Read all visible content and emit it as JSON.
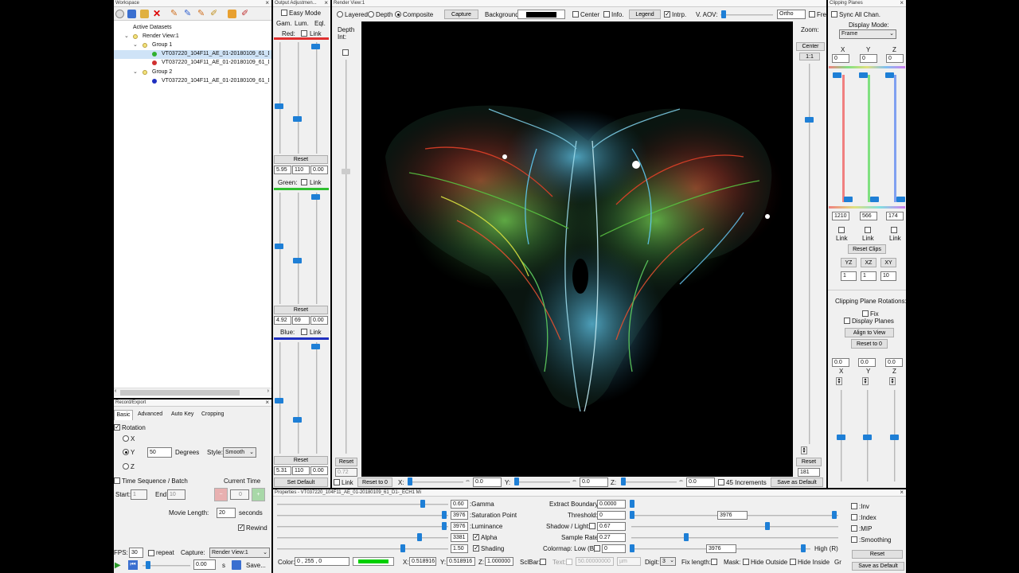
{
  "workspace": {
    "title": "Workspace",
    "tree": {
      "root": "Active Datasets",
      "view": "Render View:1",
      "group1": "Group 1",
      "g1_item1": "VT037220_104F11_AE_01-20180109_61_D1",
      "g1_item2": "VT037220_104F11_AE_01-20180109_61_D1",
      "group2": "Group 2",
      "g2_item1": "VT037220_104F11_AE_01-20180109_61_D1"
    }
  },
  "record": {
    "title": "Record/Export",
    "tabs": [
      "Basic",
      "Advanced",
      "Auto Key",
      "Cropping"
    ],
    "rotation_label": "Rotation",
    "x_label": "X",
    "y_label": "Y",
    "z_label": "Z",
    "degrees_value": "50",
    "degrees_label": "Degrees",
    "style_label": "Style:",
    "style_value": "Smooth",
    "time_seq_label": "Time Sequence / Batch",
    "current_time_label": "Current Time",
    "current_time_value": "0",
    "start_label": "Start:",
    "start_value": "1",
    "end_label": "End:",
    "end_value": "10",
    "movie_length_label": "Movie Length:",
    "movie_length_value": "20",
    "seconds_label": "seconds",
    "rewind_label": "Rewind",
    "fps_label": "FPS:",
    "fps_value": "30",
    "repeat_label": "repeat",
    "capture_label": "Capture:",
    "capture_value": "Render View:1",
    "time_value": "0.00",
    "s_label": "s",
    "save_label": "Save..."
  },
  "output": {
    "title": "Output Adjustmen...",
    "easy_mode": "Easy Mode",
    "col_gam": "Gam.",
    "col_lum": "Lum.",
    "col_eql": "Eql.",
    "red_label": "Red:",
    "green_label": "Green:",
    "blue_label": "Blue:",
    "link_label": "Link",
    "reset_label": "Reset",
    "red_values": [
      "5.95",
      "110",
      "0.00"
    ],
    "green_values": [
      "4.92",
      "69",
      "0.00"
    ],
    "blue_values": [
      "5.31",
      "110",
      "0.00"
    ],
    "set_default": "Set Default"
  },
  "render": {
    "title": "Render View:1",
    "mode_layered": "Layered",
    "mode_depth": "Depth",
    "mode_composite": "Composite",
    "capture": "Capture",
    "background_label": "Background:",
    "background_color": "#000000",
    "center_label": "Center",
    "info_label": "Info.",
    "legend_label": "Legend",
    "intrp_label": "Intrp.",
    "vaov_label": "V. AOV:",
    "ortho_value": "Ortho",
    "free_label": "Free",
    "depth_int_label": "Depth Int:",
    "depth_reset": "Reset",
    "depth_value": "0.72",
    "zoom_label": "Zoom:",
    "center_btn": "Center",
    "one_to_one": "1:1",
    "zoom_reset": "Reset",
    "zoom_value": "181",
    "link_label": "Link",
    "reset_to_0": "Reset to 0",
    "x_label": "X:",
    "x_value": "0.0",
    "y_label": "Y:",
    "y_value": "0.0",
    "z_label": "Z:",
    "z_value": "0.0",
    "increments_label": "45 Increments",
    "save_default": "Save as Default"
  },
  "clipping": {
    "title": "Clipping Planes",
    "sync_label": "Sync All Chan.",
    "display_mode_label": "Display Mode:",
    "display_mode_value": "Frame",
    "x_label": "X",
    "y_label": "Y",
    "z_label": "Z",
    "min_values": [
      "0",
      "0",
      "0"
    ],
    "max_values": [
      "1210",
      "566",
      "174"
    ],
    "link_label": "Link",
    "reset_clips": "Reset Clips",
    "yz": "YZ",
    "xz": "XZ",
    "xy": "XY",
    "plane_vals": [
      "1",
      "1",
      "10"
    ],
    "rotations_label": "Clipping Plane Rotations:",
    "fix_label": "Fix",
    "display_planes_label": "Display Planes",
    "align_view": "Align to View",
    "reset_to_0": "Reset to 0",
    "rot_values": [
      "0.0",
      "0.0",
      "0.0"
    ]
  },
  "properties": {
    "title": "Properties - VT037220_104F11_AE_01-20180109_61_D1-_ECH1 Mi",
    "gamma_value": "0.60",
    "gamma_label": ":Gamma",
    "sat_value": "3976",
    "sat_label": ":Saturation Point",
    "lum_value": "3976",
    "lum_label": ":Luminance",
    "alpha_value": "3381",
    "alpha_label": "Alpha",
    "shading_value": "1.50",
    "shading_label": "Shading",
    "extract_label": "Extract Boundary:",
    "extract_value": "0.0000",
    "threshold_label": "Threshold:",
    "threshold_low": "0",
    "threshold_high": "3976",
    "shadow_label": "Shadow / Light:",
    "shadow_value": "0.67",
    "sample_label": "Sample Rate:",
    "sample_value": "0.27",
    "colormap_label": "Colormap: Low (B)",
    "colormap_low": "0",
    "colormap_high_value": "3976",
    "high_label": "High (R)",
    "inv_label": ":Inv",
    "index_label": ":Index",
    "mip_label": ":MIP",
    "smoothing_label": ":Smoothing",
    "reset_label": "Reset",
    "save_default": "Save as Default",
    "color_label": "Color:",
    "color_value": "0 , 255 , 0",
    "color_swatch": "#00d000",
    "xc_label": "X:",
    "xc_value": "0.518916",
    "yc_label": "Y:",
    "yc_value": "0.518916",
    "zc_label": "Z:",
    "zc_value": "1.000000",
    "sclbar_label": "SclBar:",
    "text_label": "Text:",
    "text_value": "50.00000000",
    "unit_value": "µm",
    "digit_label": "Digit:",
    "digit_value": "3",
    "fixlength_label": "Fix length:",
    "mask_label": "Mask:",
    "hide_outside": "Hide Outside",
    "hide_inside": "Hide Inside",
    "gr_label": "Gr"
  },
  "colors": {
    "red_channel": "#e03030",
    "green_channel": "#30c030",
    "blue_channel": "#2030c0",
    "thumb": "#1e7fd6"
  }
}
